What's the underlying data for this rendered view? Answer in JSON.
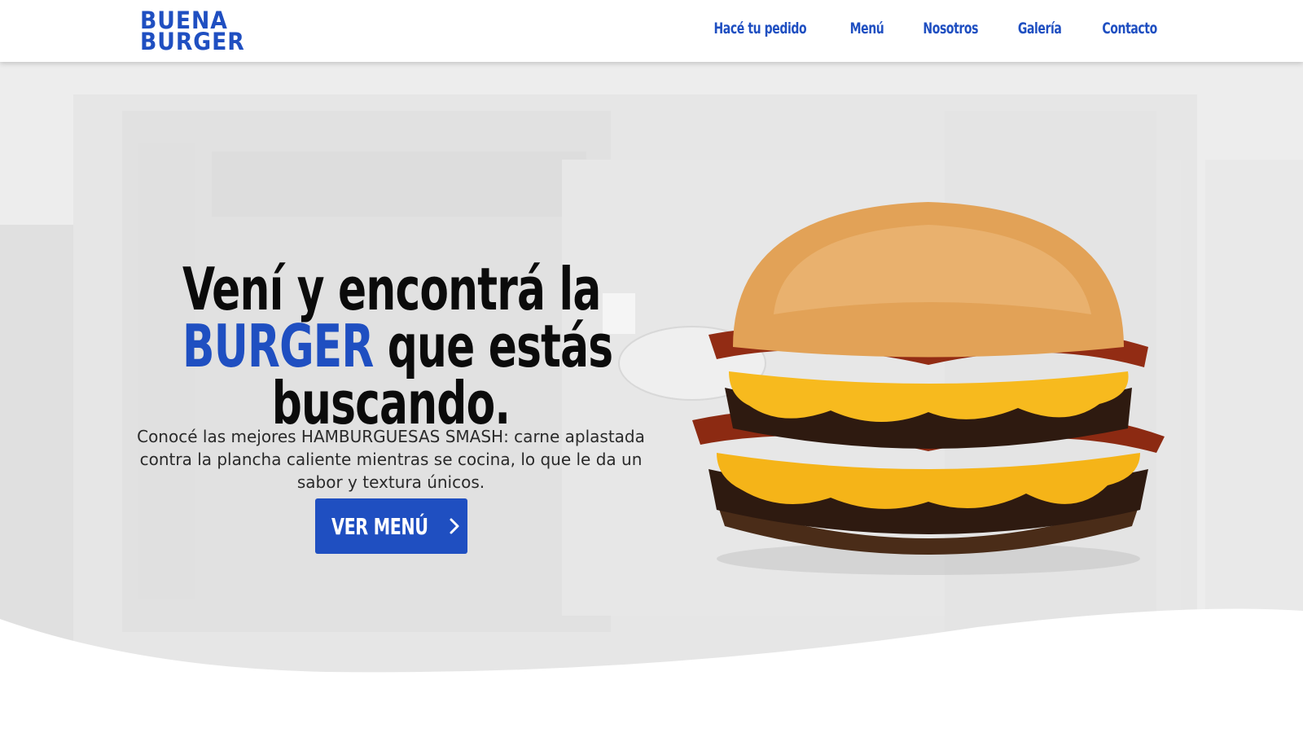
{
  "brand": {
    "logo_line1": "BUENA",
    "logo_line2": "BURGER",
    "accent_color": "#1f4fc1"
  },
  "nav": {
    "items": [
      {
        "label": "Hacé tu pedido"
      },
      {
        "label": "Menú"
      },
      {
        "label": "Nosotros"
      },
      {
        "label": "Galería"
      },
      {
        "label": "Contacto"
      }
    ]
  },
  "hero": {
    "headline_line1": "Vení y encontrá la",
    "headline_accent": "BURGER",
    "headline_line2_rest": " que estás",
    "headline_line3": "buscando.",
    "subtitle": "Conocé las mejores HAMBURGUESAS SMASH: carne aplastada contra la plancha caliente mientras se cocina, lo que le da un sabor y textura únicos.",
    "cta_label": "VER MENÚ",
    "cta_icon": "chevron-right-icon"
  },
  "icons": {
    "background": "storefront-photo",
    "product": "burger-photo"
  }
}
